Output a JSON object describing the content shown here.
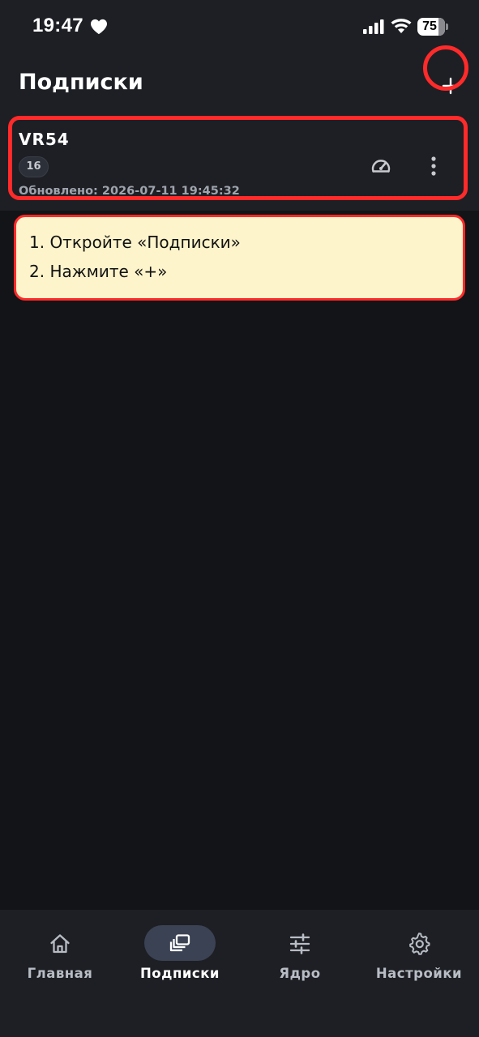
{
  "status_bar": {
    "time": "19:47",
    "battery": "75",
    "battery_fraction": 0.75
  },
  "header": {
    "title": "Подписки",
    "add_icon": "plus-icon"
  },
  "subscription": {
    "name": "VR54",
    "count": "16",
    "updated": "Обновлено: 2026-07-11 19:45:32",
    "actions": [
      "speedometer-icon",
      "more-vertical-icon"
    ]
  },
  "note": {
    "line1": "1. Откройте «Подписки»",
    "line2": "2. Нажмите «+»"
  },
  "bottom_nav": {
    "items": [
      {
        "label": "Главная",
        "icon": "home-icon",
        "active": false
      },
      {
        "label": "Подписки",
        "icon": "subscriptions-icon",
        "active": true
      },
      {
        "label": "Ядро",
        "icon": "sliders-icon",
        "active": false
      },
      {
        "label": "Настройки",
        "icon": "gear-icon",
        "active": false
      }
    ]
  },
  "colors": {
    "background": "#131417",
    "surface": "#1d1f24",
    "highlight": "#ff2a2a",
    "note_background": "#fdf4cb",
    "active_pill": "#3b4254"
  }
}
